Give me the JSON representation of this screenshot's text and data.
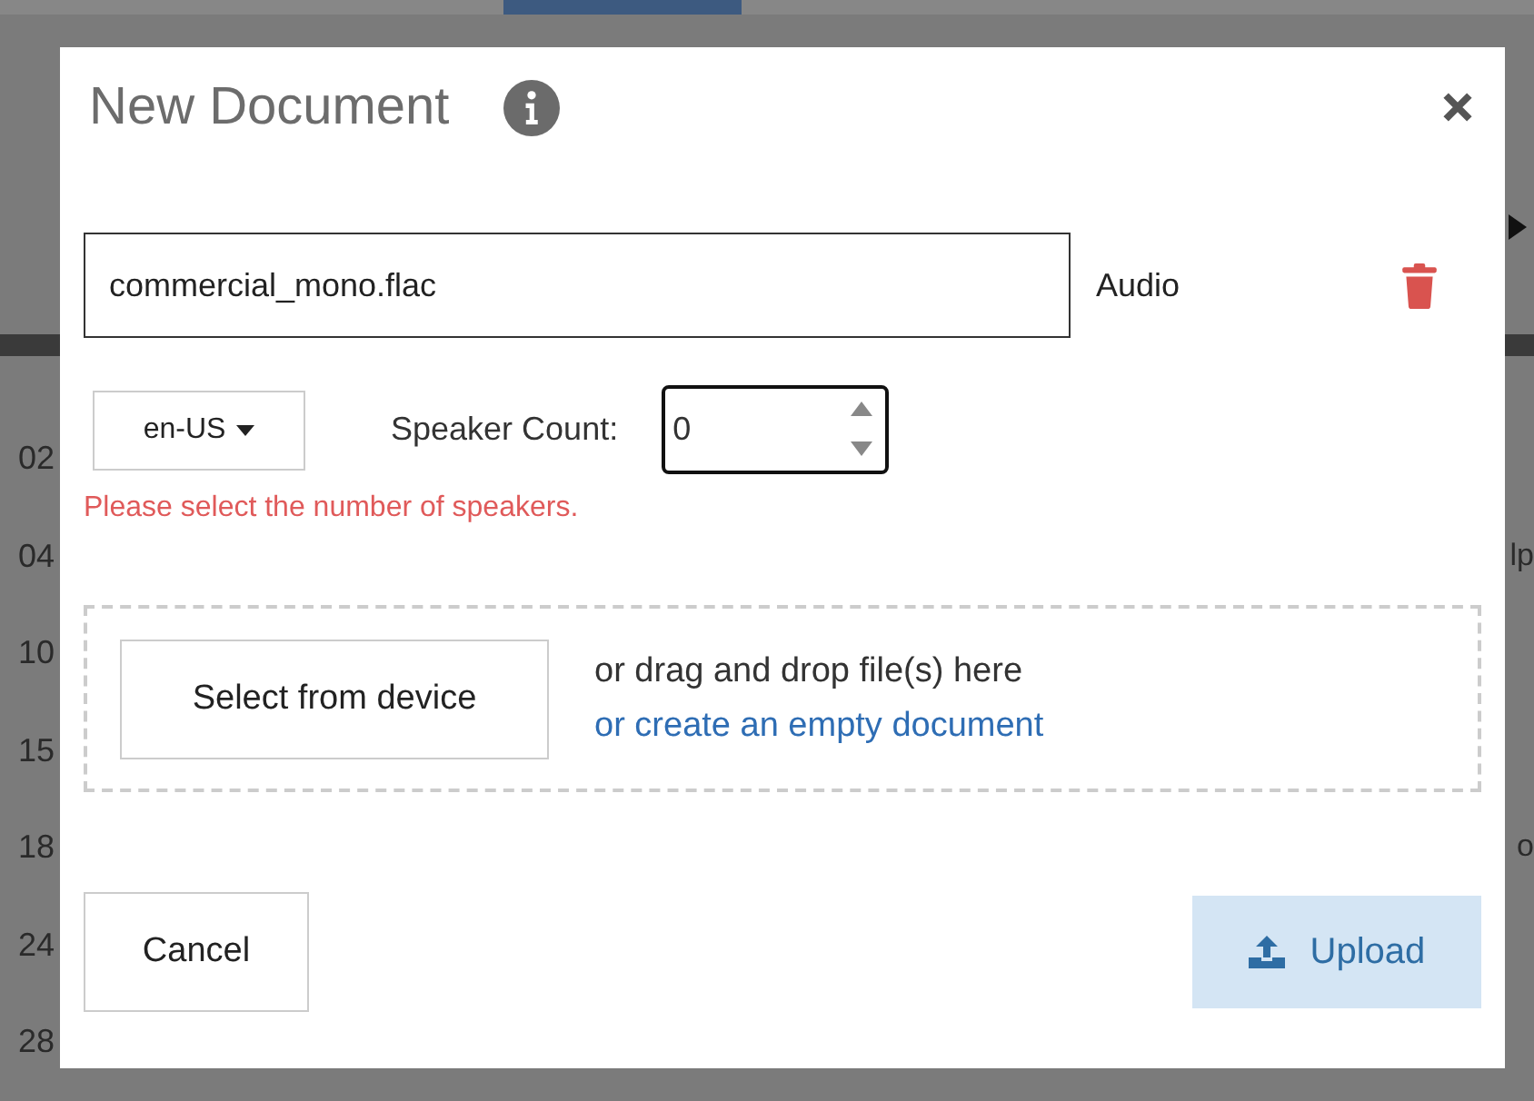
{
  "background": {
    "rows": [
      {
        "time": "02"
      },
      {
        "time": "04",
        "tail": "lp"
      },
      {
        "time": "10"
      },
      {
        "time": "15"
      },
      {
        "time": "18",
        "tail": "o"
      },
      {
        "time": "24"
      },
      {
        "time": "28"
      }
    ]
  },
  "dialog": {
    "title": "New Document",
    "file": {
      "value": "commercial_mono.flac",
      "type": "Audio"
    },
    "language": {
      "value": "en-US"
    },
    "speaker_count": {
      "label": "Speaker Count:",
      "value": "0"
    },
    "error": "Please select the number of speakers.",
    "dropzone": {
      "button": "Select from device",
      "hint": "or drag and drop file(s) here",
      "link": "or create an empty document"
    },
    "buttons": {
      "cancel": "Cancel",
      "upload": "Upload"
    }
  }
}
